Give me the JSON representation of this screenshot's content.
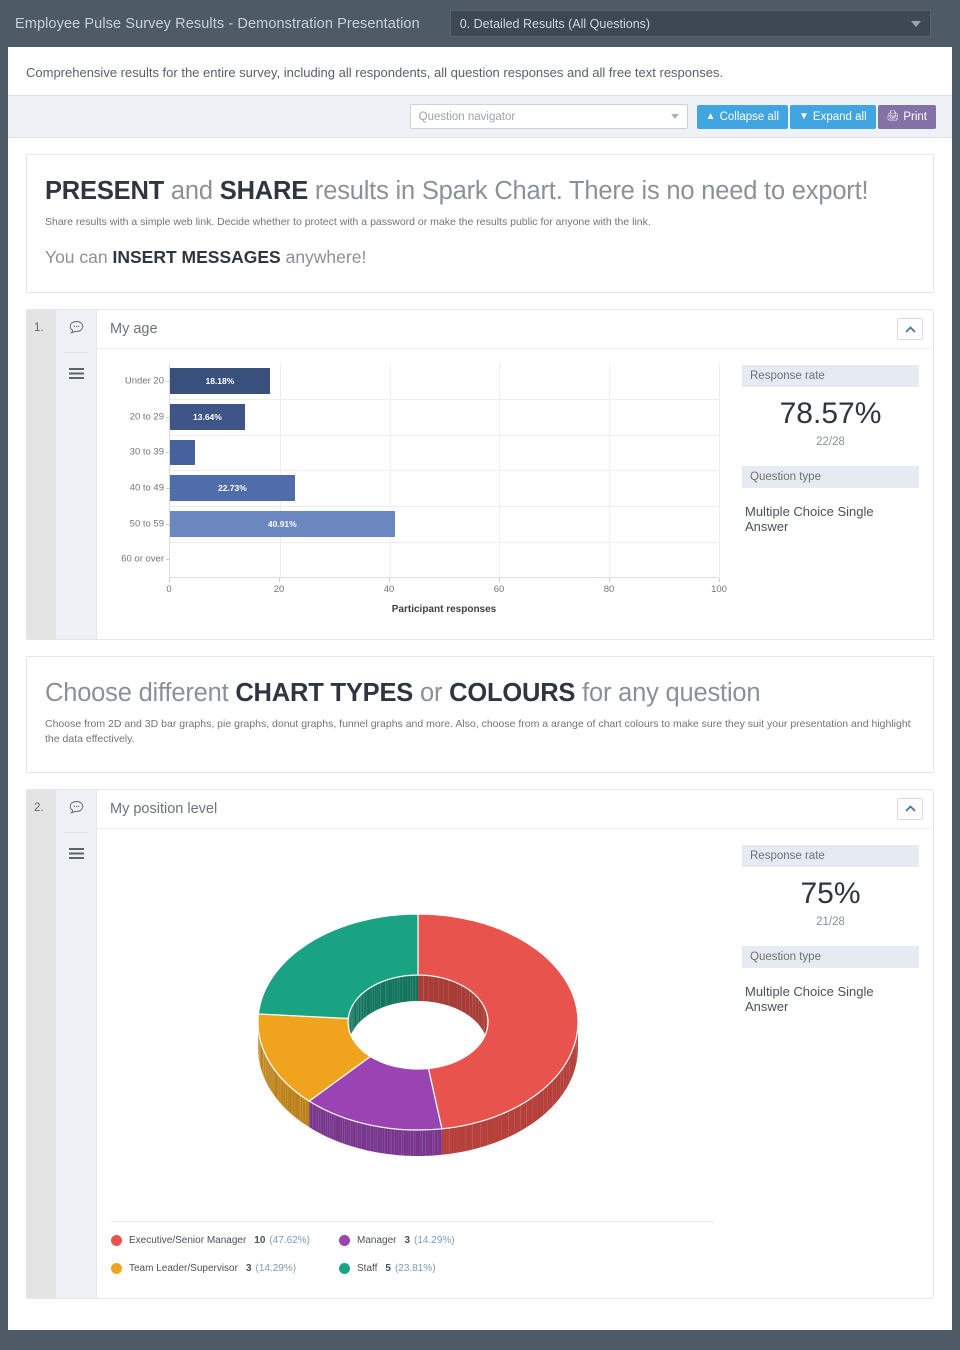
{
  "topbar": {
    "title": "Employee Pulse Survey Results - Demonstration Presentation",
    "selected_view": "0. Detailed Results (All Questions)"
  },
  "intro": "Comprehensive results for the entire survey, including all respondents, all question responses and all free text responses.",
  "toolbar": {
    "navigator_placeholder": "Question navigator",
    "collapse_all": "Collapse all",
    "expand_all": "Expand all",
    "print": "Print",
    "accent_blue": "#40a5e0",
    "accent_purple": "#8272a6"
  },
  "messages": [
    {
      "heading_parts": [
        "PRESENT",
        " and ",
        "SHARE",
        " results in Spark Chart. There is no need to export!"
      ],
      "sub": "Share results with a simple web link. Decide whether to protect with a password or make the results public for anyone with the link.",
      "second_line": [
        "You can ",
        "INSERT MESSAGES",
        " anywhere!"
      ]
    },
    {
      "heading_parts": [
        "Choose different ",
        "CHART TYPES",
        " or ",
        "COLOURS",
        " for any question"
      ],
      "sub": "Choose from 2D and 3D bar graphs, pie graphs, donut graphs, funnel graphs and more. Also, choose from a arange of chart colours to make sure they suit your presentation and highlight the data effectively."
    }
  ],
  "questions": [
    {
      "number": "1.",
      "title": "My age",
      "response_rate_label": "Response rate",
      "response_rate": "78.57%",
      "response_counts": "22/28",
      "question_type_label": "Question type",
      "question_type": "Multiple Choice Single Answer"
    },
    {
      "number": "2.",
      "title": "My position level",
      "response_rate_label": "Response rate",
      "response_rate": "75%",
      "response_counts": "21/28",
      "question_type_label": "Question type",
      "question_type": "Multiple Choice Single Answer"
    }
  ],
  "chart_data": [
    {
      "type": "bar",
      "orientation": "horizontal",
      "title": "My age",
      "xlabel": "Participant responses",
      "ylabel": "",
      "xlim": [
        0,
        100
      ],
      "xticks": [
        0,
        20,
        40,
        60,
        80,
        100
      ],
      "grid": true,
      "categories": [
        "Under 20",
        "20 to 29",
        "30 to 39",
        "40 to 49",
        "50 to 59",
        "60 or over"
      ],
      "values": [
        18.18,
        13.64,
        4.55,
        22.73,
        40.91,
        0
      ],
      "data_labels": [
        "18.18%",
        "13.64%",
        "",
        "22.73%",
        "40.91%",
        ""
      ],
      "colors": [
        "#39507c",
        "#3d5589",
        "#46619b",
        "#4f6cab",
        "#6a87c0",
        "#6a87c0"
      ]
    },
    {
      "type": "pie",
      "variant": "donut-3d",
      "title": "My position level",
      "legend_position": "bottom",
      "labels": [
        "Executive/Senior Manager",
        "Manager",
        "Team Leader/Supervisor",
        "Staff"
      ],
      "values": [
        10,
        3,
        3,
        5
      ],
      "percentages": [
        "47.62%",
        "14.29%",
        "14.29%",
        "23.81%"
      ],
      "colors": [
        "#e9534d",
        "#9a44b3",
        "#f0a41e",
        "#1aa383"
      ]
    }
  ],
  "icons": {
    "comment": "comment-icon",
    "menu": "menu-icon",
    "chevron_up": "chevron-up-icon",
    "printer": "printer-icon"
  }
}
